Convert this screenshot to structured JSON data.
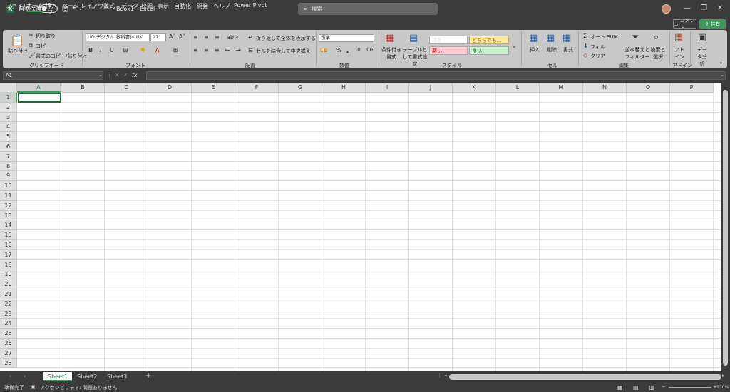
{
  "titlebar": {
    "autosave_label": "自動保存",
    "autosave_state": "オフ",
    "title": "Book1  -  Excel",
    "search_placeholder": "検索"
  },
  "menu": {
    "items": [
      "ファイル",
      "ホーム",
      "挿入",
      "ページ レイアウト",
      "数式",
      "データ",
      "校閲",
      "表示",
      "自動化",
      "開発",
      "ヘルプ",
      "Power Pivot"
    ],
    "active": "ホーム",
    "comment_label": "コメント",
    "share_label": "共有"
  },
  "ribbon": {
    "clipboard": {
      "paste": "貼り付け",
      "cut": "切り取り",
      "copy": "コピー",
      "format_painter": "書式のコピー/貼り付け",
      "label": "クリップボード"
    },
    "font": {
      "family": "UD デジタル 教科書体 NK",
      "size": "11",
      "label": "フォント"
    },
    "alignment": {
      "wrap": "折り返して全体を表示する",
      "merge": "セルを結合して中央揃え",
      "label": "配置"
    },
    "number": {
      "format": "標準",
      "label": "数値"
    },
    "styles": {
      "conditional": "条件付き書式",
      "table": "テーブルとして書式設定",
      "normal": "標準",
      "neutral": "どちらでも...",
      "bad": "悪い",
      "good": "良い",
      "label": "スタイル"
    },
    "cells": {
      "insert": "挿入",
      "delete": "削除",
      "format": "書式",
      "label": "セル"
    },
    "editing": {
      "autosum": "オート SUM",
      "fill": "フィル",
      "clear": "クリア",
      "sort": "並べ替えとフィルター",
      "find": "検索と選択",
      "label": "編集"
    },
    "addins": {
      "addin": "アドイン",
      "label": "アドイン"
    },
    "analysis": {
      "analyze": "データ分析"
    }
  },
  "formula": {
    "namebox": "A1",
    "fx": "fx"
  },
  "grid": {
    "columns": [
      "A",
      "B",
      "C",
      "D",
      "E",
      "F",
      "G",
      "H",
      "I",
      "J",
      "K",
      "L",
      "M",
      "N",
      "O",
      "P"
    ],
    "rows": [
      "1",
      "2",
      "3",
      "4",
      "5",
      "6",
      "7",
      "8",
      "9",
      "10",
      "11",
      "12",
      "13",
      "14",
      "15",
      "16",
      "17",
      "18",
      "19",
      "20",
      "21",
      "22",
      "23",
      "24",
      "25",
      "26",
      "27",
      "28"
    ],
    "selected_cell": "A1"
  },
  "sheets": {
    "tabs": [
      "Sheet1",
      "Sheet2",
      "Sheet3"
    ],
    "active": "Sheet1",
    "add": "+"
  },
  "status": {
    "ready": "準備完了",
    "accessibility": "アクセシビリティ: 問題ありません",
    "zoom": "130%"
  },
  "colors": {
    "accent": "#3d9a5a",
    "excel_green": "#1e7145",
    "titlebar": "#3b3b3b",
    "ribbon": "#c8c8c8"
  }
}
